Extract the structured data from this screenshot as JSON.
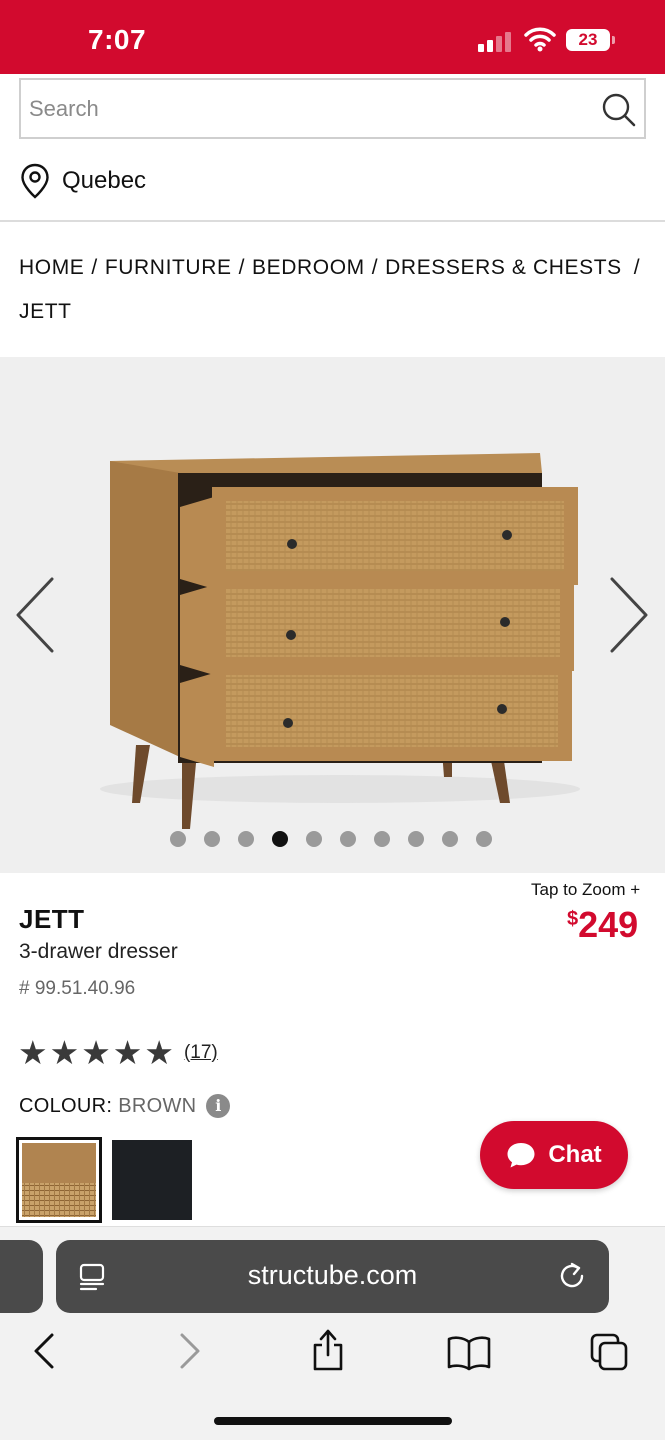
{
  "status_bar": {
    "time": "7:07",
    "battery": "23"
  },
  "search": {
    "placeholder": "Search"
  },
  "location": {
    "label": "Quebec"
  },
  "breadcrumb": {
    "items": [
      "HOME",
      "FURNITURE",
      "BEDROOM",
      "DRESSERS & CHESTS",
      "JETT"
    ],
    "separator": "/"
  },
  "gallery": {
    "dot_count": 10,
    "active_index": 3
  },
  "product": {
    "tap_to_zoom": "Tap to Zoom +",
    "price_currency": "$",
    "price_value": "249",
    "name": "JETT",
    "subtitle": "3-drawer dresser",
    "sku": "# 99.51.40.96",
    "rating_stars": 5,
    "review_count": "(17)",
    "colour_label": "COLOUR:",
    "colour_value": "BROWN",
    "swatches": [
      "brown",
      "black"
    ]
  },
  "chat": {
    "label": "Chat"
  },
  "browser": {
    "url": "structube.com"
  },
  "colors": {
    "brand_red": "#d20a2e",
    "url_bar": "#4a4a4a"
  }
}
